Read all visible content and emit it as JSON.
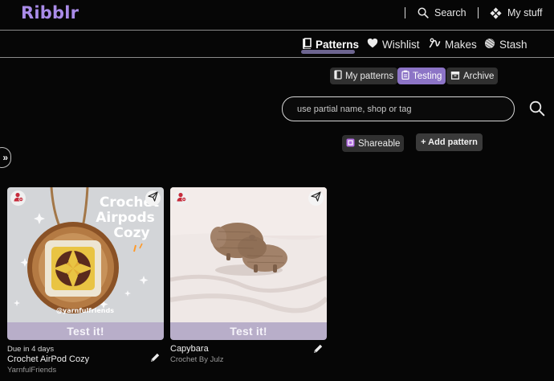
{
  "app": {
    "logo": "Ribblr"
  },
  "header": {
    "search_label": "Search",
    "mystuff_label": "My stuff",
    "search_icon": "search-icon",
    "mystuff_icon": "diamond-grid-icon"
  },
  "nav": {
    "tabs": [
      {
        "label": "Patterns",
        "icon": "book-icon",
        "active": true
      },
      {
        "label": "Wishlist",
        "icon": "heart-icon"
      },
      {
        "label": "Makes",
        "icon": "yarn-hook-icon"
      },
      {
        "label": "Stash",
        "icon": "yarn-ball-icon"
      }
    ]
  },
  "subtabs": [
    {
      "label": "My patterns",
      "icon": "book-icon"
    },
    {
      "label": "Testing",
      "icon": "clipboard-icon",
      "active": true
    },
    {
      "label": "Archive",
      "icon": "archive-box-icon"
    }
  ],
  "search": {
    "placeholder": "use partial name, shop or tag"
  },
  "actions": {
    "shareable": "Shareable",
    "add_pattern": "+ Add pattern"
  },
  "side_toggle": "»",
  "cards": [
    {
      "image_text_top": "Crochet Airpods Cozy",
      "image_text_bottom": "@yarnfulfriends",
      "test_label": "Test it!",
      "due": "Due in 4 days",
      "title": "Crochet AirPod Cozy",
      "designer": "YarnfulFriends"
    },
    {
      "test_label": "Test it!",
      "title": "Capybara",
      "designer": "Crochet By Julz"
    }
  ],
  "colors": {
    "background": "#060606",
    "logo": "#a98be8",
    "accent": "#8c74c6",
    "test_bar": "#b8aec9",
    "badge_red": "#c62c3c"
  }
}
